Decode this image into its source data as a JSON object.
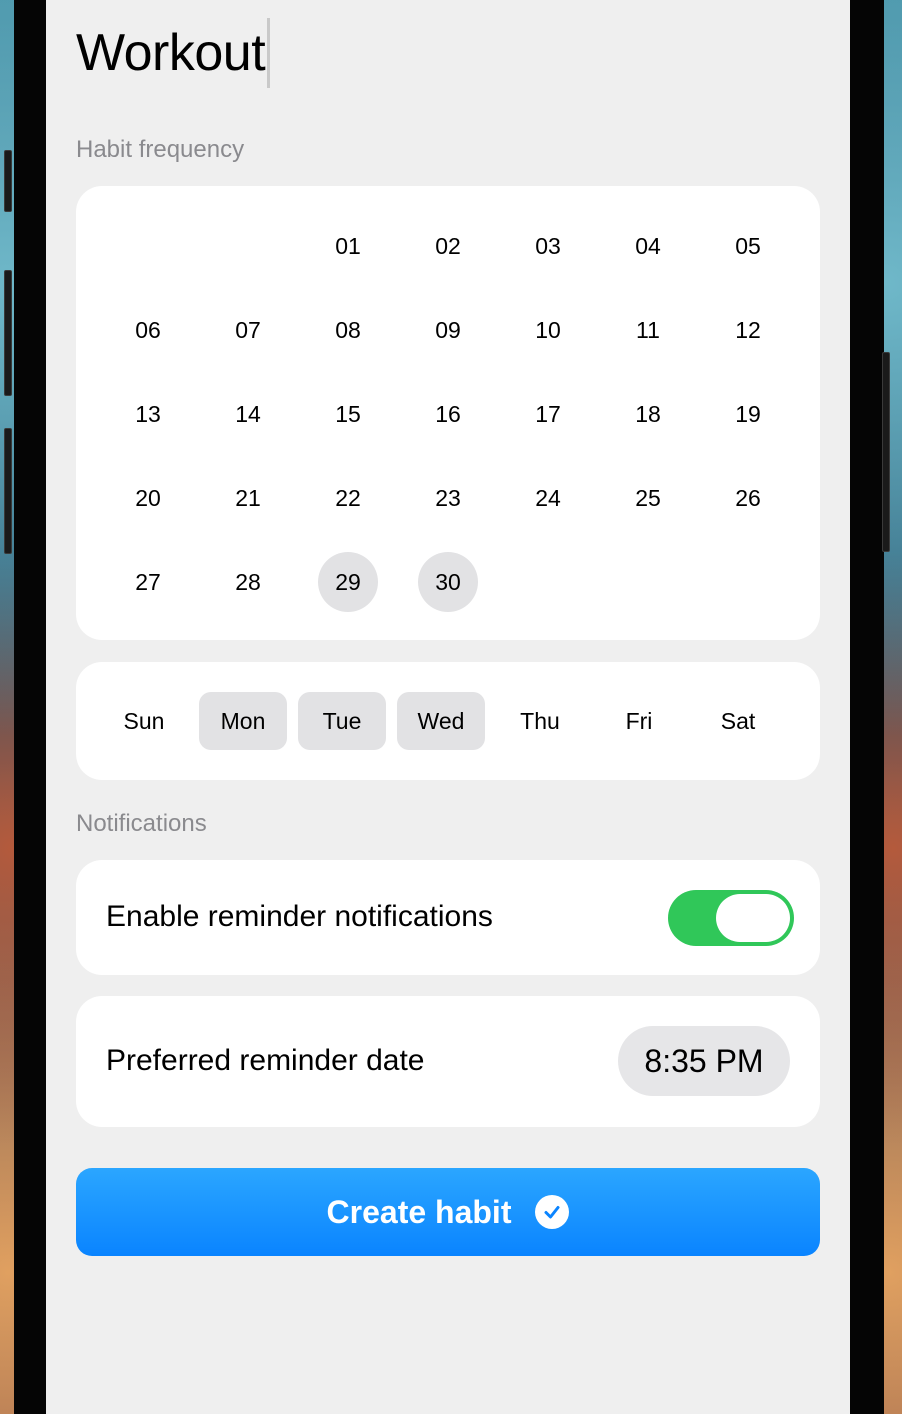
{
  "title": "Workout",
  "frequency": {
    "label": "Habit frequency",
    "calendar": [
      [
        "",
        "",
        "01",
        "02",
        "03",
        "04",
        "05"
      ],
      [
        "06",
        "07",
        "08",
        "09",
        "10",
        "11",
        "12"
      ],
      [
        "13",
        "14",
        "15",
        "16",
        "17",
        "18",
        "19"
      ],
      [
        "20",
        "21",
        "22",
        "23",
        "24",
        "25",
        "26"
      ],
      [
        "27",
        "28",
        "29",
        "30",
        "",
        "",
        ""
      ]
    ],
    "selected_days": [
      "29",
      "30"
    ],
    "weekdays": [
      "Sun",
      "Mon",
      "Tue",
      "Wed",
      "Thu",
      "Fri",
      "Sat"
    ],
    "selected_weekdays": [
      "Mon",
      "Tue",
      "Wed"
    ]
  },
  "notifications": {
    "label": "Notifications",
    "enable_label": "Enable reminder notifications",
    "enabled": true,
    "reminder_label": "Preferred reminder date",
    "reminder_time": "8:35 PM"
  },
  "create_button": {
    "label": "Create habit"
  },
  "colors": {
    "toggle_on": "#30c759",
    "accent": "#0a84ff",
    "selected_bg": "#e2e2e4"
  }
}
